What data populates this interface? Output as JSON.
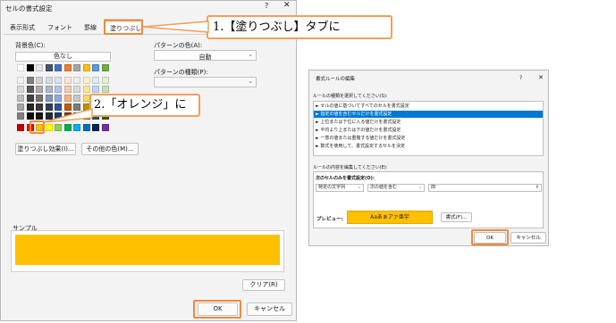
{
  "format_cells": {
    "title": "セルの書式設定",
    "help": "?",
    "close": "✕",
    "tabs": [
      "表示形式",
      "フォント",
      "罫線",
      "塗りつぶし"
    ],
    "active_tab": "塗りつぶし",
    "background_label": "背景色(C):",
    "no_color": "色なし",
    "pattern_color_label": "パターンの色(A):",
    "pattern_color_value": "自動",
    "pattern_type_label": "パターンの種類(P):",
    "pattern_type_value": "",
    "fill_effects_button": "塗りつぶし効果(I)...",
    "more_colors_button": "その他の色(M)...",
    "sample_label": "サンプル",
    "sample_color": "#FFC000",
    "clear_button": "クリア(R)",
    "ok_button": "OK",
    "cancel_button": "キャンセル",
    "palette": {
      "theme_top": [
        "#ffffff",
        "#000000",
        "#e7e6e6",
        "#44546a",
        "#4472c4",
        "#ed7d31",
        "#a5a5a5",
        "#ffc000",
        "#5b9bd5",
        "#70ad47"
      ],
      "theme_shades": [
        [
          "#f2f2f2",
          "#808080",
          "#d0cece",
          "#d6dce4",
          "#d9e2f3",
          "#fbe5d5",
          "#ededed",
          "#fff2cc",
          "#deebf6",
          "#e2efd9"
        ],
        [
          "#d9d9d9",
          "#595959",
          "#aeabab",
          "#adb9ca",
          "#b4c6e7",
          "#f7cbac",
          "#dbdbdb",
          "#fee599",
          "#bdd7ee",
          "#c5e0b3"
        ],
        [
          "#bfbfbf",
          "#404040",
          "#757070",
          "#8496b0",
          "#8eaadb",
          "#f4b183",
          "#c9c9c9",
          "#ffd966",
          "#9dc3e6",
          "#a8d08d"
        ],
        [
          "#a6a6a6",
          "#262626",
          "#3a3838",
          "#323f4f",
          "#2f5496",
          "#c55a11",
          "#7b7b7b",
          "#bf9000",
          "#2e75b5",
          "#538135"
        ],
        [
          "#808080",
          "#0d0d0d",
          "#171616",
          "#222a35",
          "#1f3864",
          "#833c0b",
          "#525252",
          "#7f6000",
          "#1e4e79",
          "#375623"
        ]
      ],
      "standard": [
        "#c00000",
        "#ff0000",
        "#ffc000",
        "#ffff00",
        "#92d050",
        "#00b050",
        "#00b0f0",
        "#0070c0",
        "#002060",
        "#7030a0"
      ],
      "selected": "#ffc000"
    }
  },
  "callouts": {
    "step1": "1.【塗りつぶし】タブに",
    "step2": "2.「オレンジ」に"
  },
  "edit_rule": {
    "title": "書式ルールの編集",
    "help": "?",
    "close": "✕",
    "select_type_label": "ルールの種類を選択してください(S):",
    "rule_types": [
      "► セルの値に基づいてすべてのセルを書式設定",
      "► 指定の値を含むセルだけを書式設定",
      "► 上位または下位に入る値だけを書式設定",
      "► 平均より上または下の値だけを書式設定",
      "► 一意の値または重複する値だけを書式設定",
      "► 数式を使用して、書式設定するセルを決定"
    ],
    "selected_rule_index": 1,
    "edit_desc_label": "ルールの内容を編集してください(E):",
    "format_only_label": "次のセルのみを書式設定(O):",
    "condition1": "特定の文字列",
    "condition2": "次の値を含む",
    "condition_value": "田",
    "preview_label": "プレビュー:",
    "preview_text": "Aaあぁアァ亜宇",
    "format_button": "書式(F)...",
    "ok_button": "OK",
    "cancel_button": "キャンセル"
  },
  "colors": {
    "accent_orange": "#F08A3C",
    "selection_blue": "#0078D4"
  }
}
